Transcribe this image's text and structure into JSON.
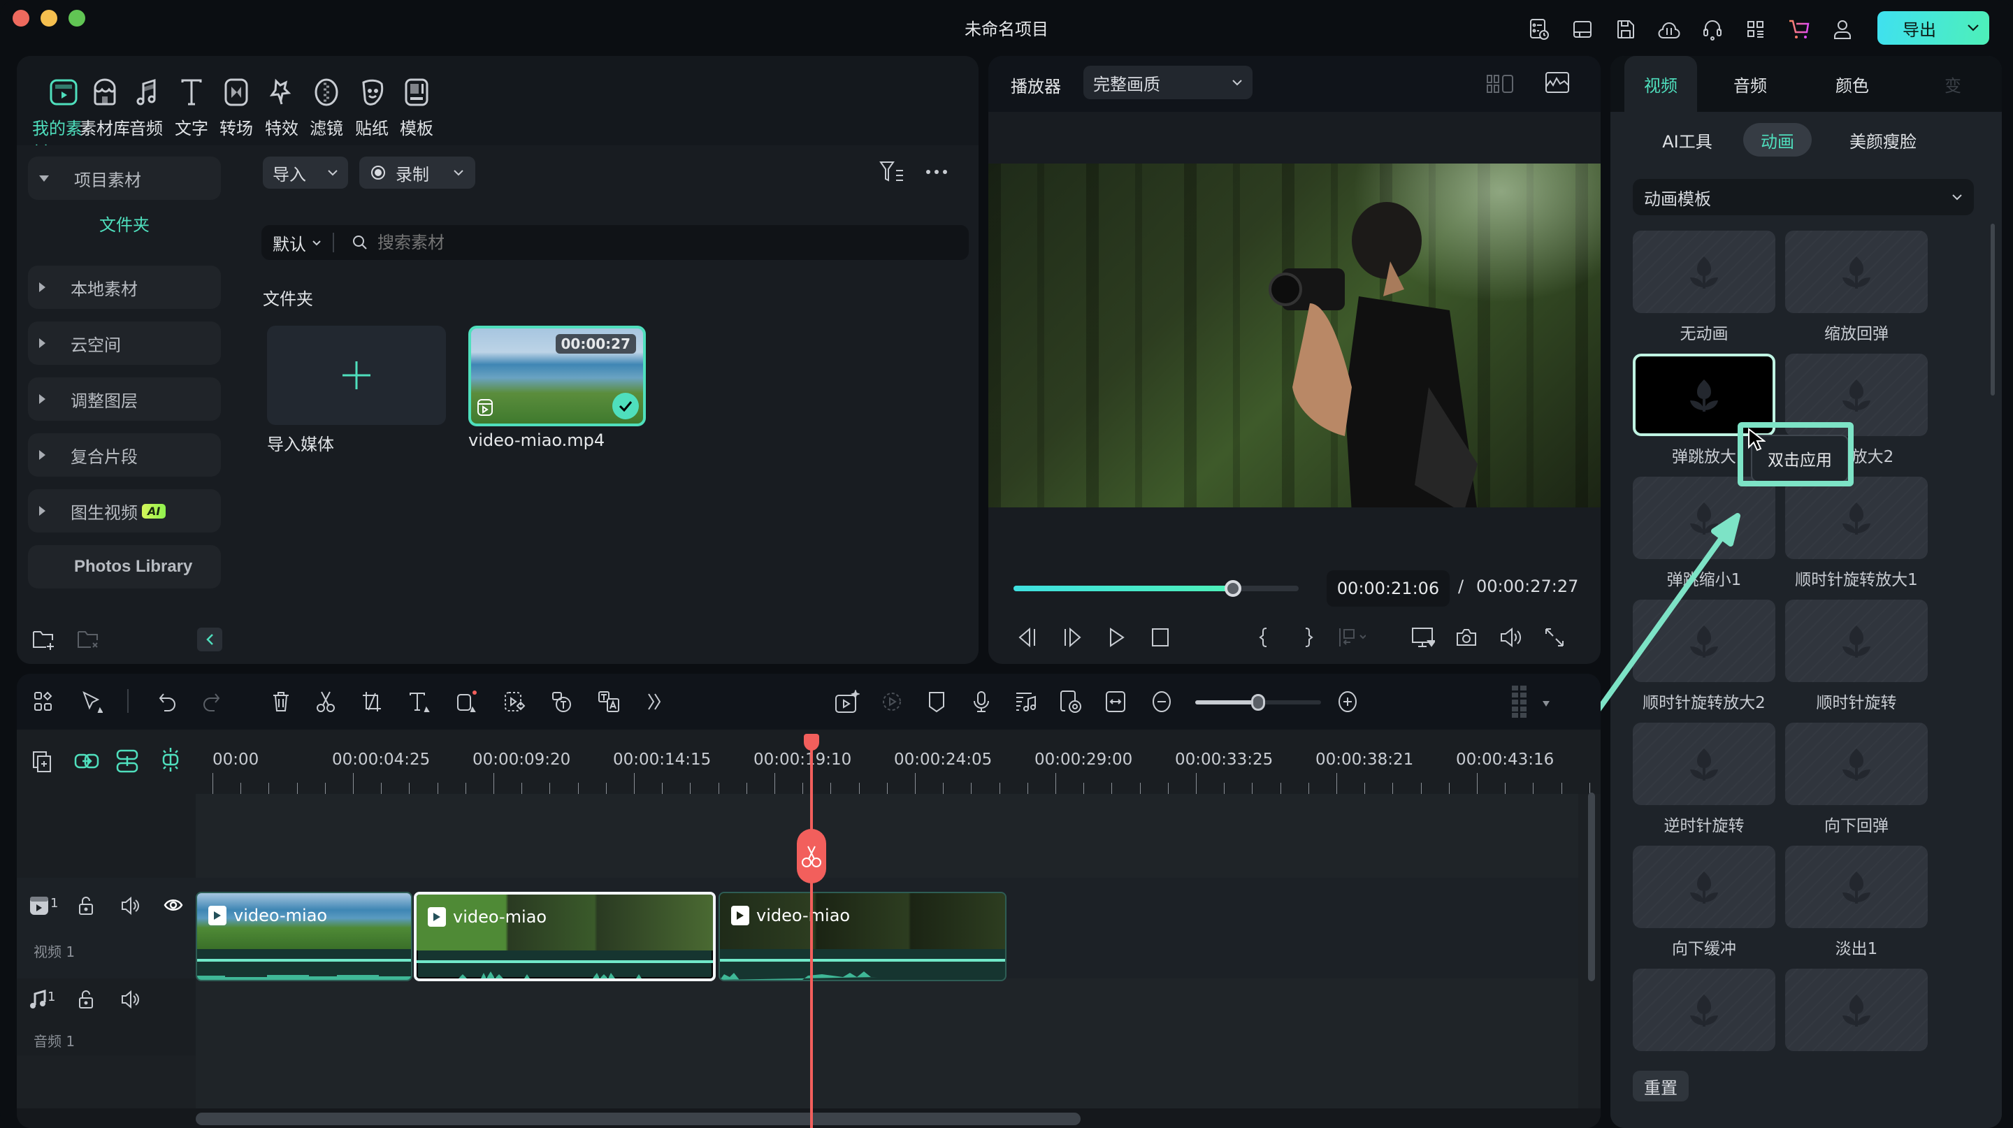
{
  "window": {
    "title": "未命名项目",
    "export_label": "导出",
    "toolbar_icons": [
      "task-list-icon",
      "layout-icon",
      "save-icon",
      "cloud-sync-icon",
      "support-headset-icon",
      "apps-grid-icon",
      "cart-icon",
      "user-icon"
    ]
  },
  "media_categories": [
    {
      "label": "我的素材",
      "icon": "my-media-icon",
      "active": true
    },
    {
      "label": "素材库",
      "icon": "library-icon"
    },
    {
      "label": "音频",
      "icon": "music-note-icon"
    },
    {
      "label": "文字",
      "icon": "text-icon"
    },
    {
      "label": "转场",
      "icon": "transition-icon"
    },
    {
      "label": "特效",
      "icon": "effects-icon"
    },
    {
      "label": "滤镜",
      "icon": "filter-icon"
    },
    {
      "label": "贴纸",
      "icon": "sticker-icon"
    },
    {
      "label": "模板",
      "icon": "template-icon"
    }
  ],
  "sidebar": {
    "items": [
      {
        "label": "项目素材",
        "expanded": true
      },
      {
        "label": "本地素材"
      },
      {
        "label": "云空间"
      },
      {
        "label": "调整图层"
      },
      {
        "label": "复合片段"
      },
      {
        "label": "图生视频",
        "badge": "AI"
      },
      {
        "label": "Photos Library"
      }
    ],
    "folder_label": "文件夹"
  },
  "media": {
    "import_label": "导入",
    "record_label": "录制",
    "sort_label": "默认",
    "search_placeholder": "搜索素材",
    "section_title": "文件夹",
    "import_media_label": "导入媒体",
    "items": [
      {
        "name": "video-miao.mp4",
        "duration": "00:00:27",
        "selected": true
      }
    ]
  },
  "player": {
    "label": "播放器",
    "quality": "完整画质",
    "current_time": "00:00:21:06",
    "separator": "/",
    "total_time": "00:00:27:27",
    "progress": 0.77
  },
  "properties": {
    "tabs": [
      {
        "label": "视频",
        "active": true
      },
      {
        "label": "音频"
      },
      {
        "label": "颜色"
      },
      {
        "label": "变"
      }
    ],
    "sub_tabs": [
      {
        "label": "AI工具"
      },
      {
        "label": "动画",
        "active": true
      },
      {
        "label": "美颜瘦脸"
      }
    ],
    "dropdown": "动画模板",
    "animations": [
      {
        "label": "无动画"
      },
      {
        "label": "缩放回弹"
      },
      {
        "label": "弹跳放大",
        "selected": true
      },
      {
        "label": "弹跳放大2"
      },
      {
        "label": "弹跳缩小1"
      },
      {
        "label": "顺时针旋转放大1"
      },
      {
        "label": "顺时针旋转放大2"
      },
      {
        "label": "顺时针旋转"
      },
      {
        "label": "逆时针旋转"
      },
      {
        "label": "向下回弹"
      },
      {
        "label": "向下缓冲"
      },
      {
        "label": "淡出1"
      },
      {
        "label": ""
      },
      {
        "label": ""
      }
    ],
    "tooltip": "双击应用",
    "reset_label": "重置"
  },
  "timeline": {
    "ruler": [
      "00:00",
      "00:00:04:25",
      "00:00:09:20",
      "00:00:14:15",
      "00:00:19:10",
      "00:00:24:05",
      "00:00:29:00",
      "00:00:33:25",
      "00:00:38:21",
      "00:00:43:16"
    ],
    "tracks": [
      {
        "type": "video",
        "index": "1",
        "name": "视频 1"
      },
      {
        "type": "audio",
        "index": "1",
        "name": "音频 1"
      }
    ],
    "clips": [
      {
        "name": "video-miao"
      },
      {
        "name": "video-miao",
        "selected": true
      },
      {
        "name": "video-miao"
      }
    ],
    "zoom_level": 0.5
  },
  "colors": {
    "accent": "#4fdfbd",
    "playhead": "#f25f5c",
    "annotation": "#7de3c6"
  }
}
